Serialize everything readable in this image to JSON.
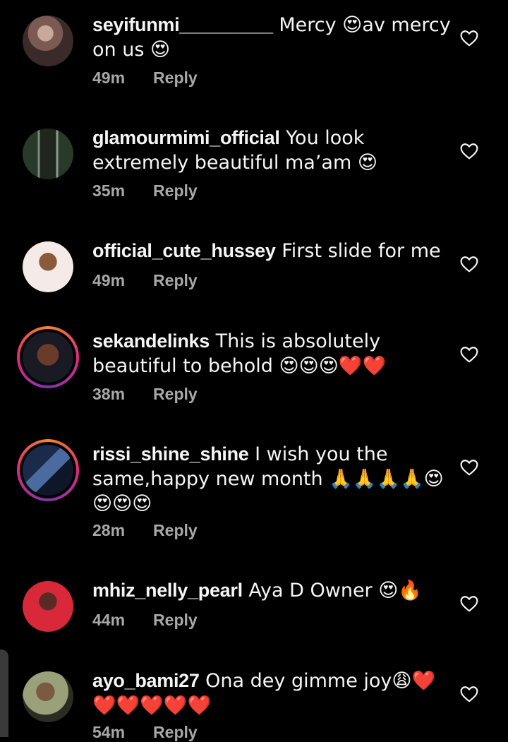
{
  "comments": [
    {
      "username": "seyifunmi_________",
      "text": " Mercy 😍av mercy on us 😍",
      "time": "49m",
      "reply": "Reply"
    },
    {
      "username": "glamourmimi_official",
      "text": " You look extremely beautiful ma’am 😍",
      "time": "35m",
      "reply": "Reply"
    },
    {
      "username": "official_cute_hussey",
      "text": " First slide for me",
      "time": "49m",
      "reply": "Reply"
    },
    {
      "username": "sekandelinks",
      "text": " This is absolutely beautiful to behold 😍😍😍❤️❤️",
      "time": "38m",
      "reply": "Reply"
    },
    {
      "username": "rissi_shine_shine",
      "text": " I wish you the same,happy new month 🙏🙏🙏🙏😍😍😍😍",
      "time": "28m",
      "reply": "Reply"
    },
    {
      "username": "mhiz_nelly_pearl",
      "text": " Aya D Owner 😍🔥",
      "time": "44m",
      "reply": "Reply"
    },
    {
      "username": "ayo_bami27",
      "text": " Ona dey gimme joy😩❤️❤️❤️❤️❤️❤️",
      "time": "54m",
      "reply": "Reply"
    }
  ],
  "icons": {
    "like": "heart-outline-icon"
  },
  "colors": {
    "background": "#000000",
    "text": "#f5f5f5",
    "meta": "#a8a8a8"
  }
}
